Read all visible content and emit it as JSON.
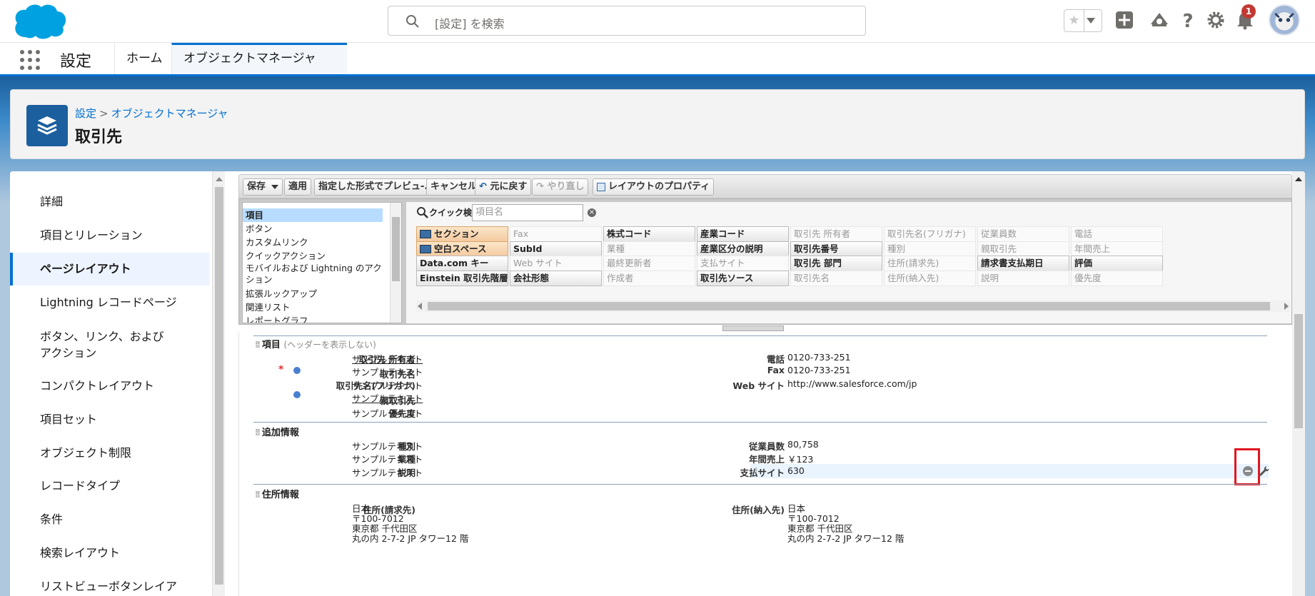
{
  "header": {
    "search_placeholder": "[設定] を検索",
    "notification_count": "1"
  },
  "nav": {
    "app_name": "設定",
    "tabs": [
      {
        "label": "ホーム"
      },
      {
        "label": "オブジェクトマネージャ"
      }
    ]
  },
  "page": {
    "breadcrumb_root": "設定",
    "breadcrumb_sep": ">",
    "breadcrumb_current": "オブジェクトマネージャ",
    "title": "取引先"
  },
  "sidebar": {
    "items": [
      {
        "label": "詳細"
      },
      {
        "label": "項目とリレーション"
      },
      {
        "label": "ページレイアウト"
      },
      {
        "label": "Lightning レコードページ"
      },
      {
        "label": "ボタン、リンク、およびアクション"
      },
      {
        "label": "コンパクトレイアウト"
      },
      {
        "label": "項目セット"
      },
      {
        "label": "オブジェクト制限"
      },
      {
        "label": "レコードタイプ"
      },
      {
        "label": "条件"
      },
      {
        "label": "検索レイアウト"
      },
      {
        "label": "リストビューボタンレイア"
      }
    ]
  },
  "toolbar": {
    "save": "保存",
    "apply": "適用",
    "preview": "指定した形式でプレビュ-...",
    "cancel": "キャンセル",
    "undo": "元に戻す",
    "redo": "やり直し",
    "properties": "レイアウトのプロパティ"
  },
  "palette": {
    "categories": [
      "項目",
      "ボタン",
      "カスタムリンク",
      "クイックアクション",
      "モバイルおよび Lightning のアクション",
      "拡張ルックアップ",
      "関連リスト",
      "レポートグラフ"
    ],
    "quick_find_label": "クイック検索",
    "quick_find_placeholder": "項目名",
    "fields": [
      [
        "セクション",
        "Fax",
        "株式コード",
        "産業コード",
        "取引先 所有者",
        "取引先名(フリガナ)",
        "従業員数",
        "電話"
      ],
      [
        "空白スペース",
        "SubId",
        "業種",
        "産業区分の説明",
        "取引先番号",
        "種別",
        "親取引先",
        "年間売上"
      ],
      [
        "Data.com キー",
        "Web サイト",
        "最終更新者",
        "支払サイト",
        "取引先 部門",
        "住所(請求先)",
        "請求書支払期日",
        "評価"
      ],
      [
        "Einstein 取引先階層",
        "会社形態",
        "作成者",
        "取引先ソース",
        "取引先名",
        "住所(納入先)",
        "説明",
        "優先度"
      ]
    ]
  },
  "layout": {
    "section1": {
      "title": "項目",
      "subtitle": "(ヘッダーを表示しない)",
      "left": [
        {
          "label": "取引先 所有者",
          "value": "サンプルテキスト"
        },
        {
          "label": "取引先名",
          "value": "サンプルテキスト"
        },
        {
          "label": "取引先名(フリガナ)",
          "value": "サンプルテキスト"
        },
        {
          "label": "親取引先",
          "value": "サンプルテキスト"
        },
        {
          "label": "優先度",
          "value": "サンプルテキスト"
        }
      ],
      "right": [
        {
          "label": "電話",
          "value": "0120-733-251"
        },
        {
          "label": "Fax",
          "value": "0120-733-251"
        },
        {
          "label": "Web サイト",
          "value": "http://www.salesforce.com/jp"
        }
      ]
    },
    "section2": {
      "title": "追加情報",
      "left": [
        {
          "label": "種別",
          "value": "サンプルテキスト"
        },
        {
          "label": "業種",
          "value": "サンプルテキスト"
        },
        {
          "label": "説明",
          "value": "サンプルテキスト"
        }
      ],
      "right": [
        {
          "label": "従業員数",
          "value": "80,758"
        },
        {
          "label": "年間売上",
          "value": "￥123"
        },
        {
          "label": "支払サイト",
          "value": "630"
        }
      ]
    },
    "section3": {
      "title": "住所情報",
      "billing_label": "住所(請求先)",
      "billing": "日本\n〒100-7012\n東京都 千代田区\n丸の内 2-7-2 JP タワー12 階",
      "shipping_label": "住所(納入先)",
      "shipping": "日本\n〒100-7012\n東京都 千代田区\n丸の内 2-7-2 JP タワー12 階"
    }
  },
  "icons": [
    "salesforce-logo",
    "search-icon",
    "star-icon",
    "add-icon",
    "trailhead-icon",
    "help-icon",
    "gear-icon",
    "bell-icon",
    "app-launcher-icon",
    "chevron-down-icon",
    "layers-icon",
    "remove-icon",
    "wrench-icon"
  ],
  "colors": {
    "brand": "#0070d2",
    "highlight_box": "#e1161f"
  }
}
